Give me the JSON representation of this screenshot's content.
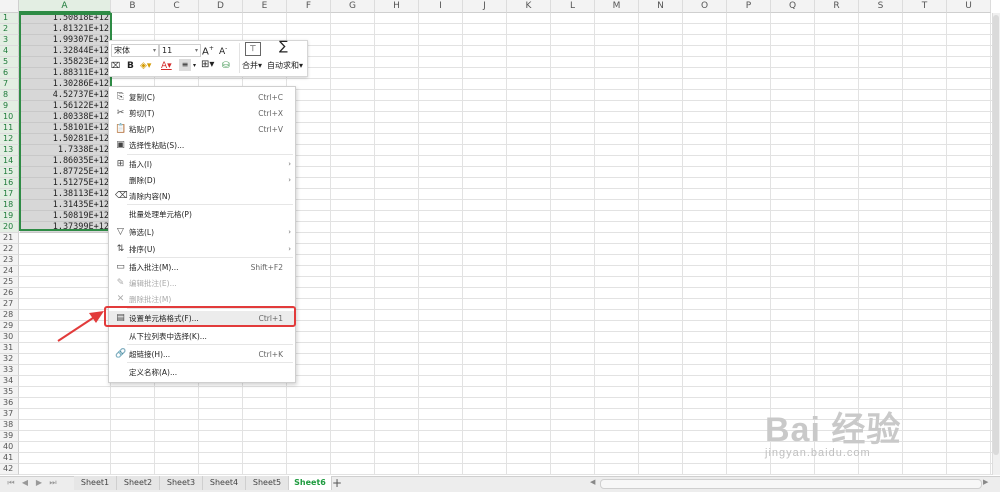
{
  "columns": [
    "A",
    "B",
    "C",
    "D",
    "E",
    "F",
    "G",
    "H",
    "I",
    "J",
    "K",
    "L",
    "M",
    "N",
    "O",
    "P",
    "Q",
    "R",
    "S",
    "T",
    "U"
  ],
  "rows": [
    "1",
    "2",
    "3",
    "4",
    "5",
    "6",
    "7",
    "8",
    "9",
    "10",
    "11",
    "12",
    "13",
    "14",
    "15",
    "16",
    "17",
    "18",
    "19",
    "20",
    "21",
    "22",
    "23",
    "24",
    "25",
    "26",
    "27",
    "28",
    "29",
    "30",
    "31",
    "32",
    "33",
    "34",
    "35",
    "36",
    "37",
    "38",
    "39",
    "40",
    "41",
    "42"
  ],
  "column_a_values": [
    "1.50818E+12",
    "1.81321E+12",
    "1.99307E+12",
    "1.32844E+12",
    "1.35823E+12",
    "1.88311E+12",
    "1.30286E+12",
    "4.52737E+12",
    "1.56122E+12",
    "1.80338E+12",
    "1.58101E+12",
    "1.50281E+12",
    "1.7338E+12",
    "1.86035E+12",
    "1.87725E+12",
    "1.51275E+12",
    "1.38113E+12",
    "1.31435E+12",
    "1.50819E+12",
    "1.37399E+12"
  ],
  "mini_toolbar": {
    "font_name": "宋体",
    "font_size": "11",
    "bold": "B",
    "merge_label": "合并",
    "autosum_label": "自动求和"
  },
  "context_menu": [
    {
      "icon": "copy-icon",
      "glyph": "⎘",
      "label": "复制(C)",
      "shortcut": "Ctrl+C",
      "enabled": true
    },
    {
      "icon": "cut-icon",
      "glyph": "✂",
      "label": "剪切(T)",
      "shortcut": "Ctrl+X",
      "enabled": true
    },
    {
      "icon": "paste-icon",
      "glyph": "📋",
      "label": "粘贴(P)",
      "shortcut": "Ctrl+V",
      "enabled": true
    },
    {
      "icon": "paste-special-icon",
      "glyph": "▣",
      "label": "选择性粘贴(S)...",
      "shortcut": "",
      "enabled": true
    },
    {
      "icon": "insert-icon",
      "glyph": "⊞",
      "label": "插入(I)",
      "shortcut": "",
      "submenu": true,
      "enabled": true
    },
    {
      "icon": "",
      "glyph": "",
      "label": "删除(D)",
      "shortcut": "",
      "submenu": true,
      "enabled": true
    },
    {
      "icon": "clear-content-icon",
      "glyph": "⌫",
      "label": "清除内容(N)",
      "shortcut": "",
      "enabled": true
    },
    {
      "icon": "",
      "glyph": "",
      "label": "批量处理单元格(P)",
      "shortcut": "",
      "enabled": true
    },
    {
      "icon": "filter-icon",
      "glyph": "▽",
      "label": "筛选(L)",
      "shortcut": "",
      "submenu": true,
      "enabled": true
    },
    {
      "icon": "sort-icon",
      "glyph": "⇅",
      "label": "排序(U)",
      "shortcut": "",
      "submenu": true,
      "enabled": true
    },
    {
      "icon": "insert-comment-icon",
      "glyph": "▭",
      "label": "插入批注(M)...",
      "shortcut": "Shift+F2",
      "enabled": true
    },
    {
      "icon": "edit-comment-icon",
      "glyph": "✎",
      "label": "编辑批注(E)...",
      "shortcut": "",
      "enabled": false
    },
    {
      "icon": "delete-comment-icon",
      "glyph": "✕",
      "label": "删除批注(M)",
      "shortcut": "",
      "enabled": false
    },
    {
      "icon": "format-cells-icon",
      "glyph": "▤",
      "label": "设置单元格格式(F)...",
      "shortcut": "Ctrl+1",
      "enabled": true,
      "highlighted": true
    },
    {
      "icon": "",
      "glyph": "",
      "label": "从下拉列表中选择(K)...",
      "shortcut": "",
      "enabled": true
    },
    {
      "icon": "hyperlink-icon",
      "glyph": "🔗",
      "label": "超链接(H)...",
      "shortcut": "Ctrl+K",
      "enabled": true
    },
    {
      "icon": "",
      "glyph": "",
      "label": "定义名称(A)...",
      "shortcut": "",
      "enabled": true
    }
  ],
  "sheet_tabs": [
    "Sheet1",
    "Sheet2",
    "Sheet3",
    "Sheet4",
    "Sheet5",
    "Sheet6"
  ],
  "active_sheet": "Sheet6",
  "add_sheet": "+",
  "colors": {
    "accent_green": "#2e8b45",
    "highlight_red": "#e23b3b",
    "tab_active": "#1e9b3f"
  },
  "watermark": {
    "logo": "Bai 经验",
    "url": "jingyan.baidu.com"
  }
}
